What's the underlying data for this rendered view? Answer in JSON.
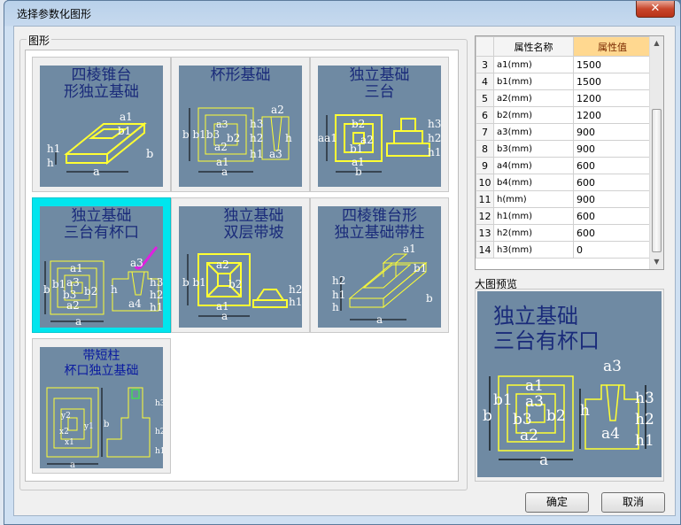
{
  "window": {
    "title": "选择参数化图形",
    "close": "✕"
  },
  "gallery": {
    "label": "图形",
    "items": [
      {
        "title": "四棱锥台\n形独立基础"
      },
      {
        "title": "杯形基础"
      },
      {
        "title": "独立基础\n三台"
      },
      {
        "title": "独立基础\n三台有杯口"
      },
      {
        "title": "独立基础\n双层带坡"
      },
      {
        "title": "四棱锥台形\n独立基础带柱"
      },
      {
        "title": "带短柱\n杯口独立基础"
      }
    ]
  },
  "properties": {
    "header_name": "属性名称",
    "header_value": "属性值",
    "rows": [
      {
        "n": "3",
        "name": "a1(mm)",
        "value": "1500"
      },
      {
        "n": "4",
        "name": "b1(mm)",
        "value": "1500"
      },
      {
        "n": "5",
        "name": "a2(mm)",
        "value": "1200"
      },
      {
        "n": "6",
        "name": "b2(mm)",
        "value": "1200"
      },
      {
        "n": "7",
        "name": "a3(mm)",
        "value": "900"
      },
      {
        "n": "8",
        "name": "b3(mm)",
        "value": "900"
      },
      {
        "n": "9",
        "name": "a4(mm)",
        "value": "600"
      },
      {
        "n": "10",
        "name": "b4(mm)",
        "value": "600"
      },
      {
        "n": "11",
        "name": "h(mm)",
        "value": "900"
      },
      {
        "n": "12",
        "name": "h1(mm)",
        "value": "600"
      },
      {
        "n": "13",
        "name": "h2(mm)",
        "value": "600"
      },
      {
        "n": "14",
        "name": "h3(mm)",
        "value": "0"
      }
    ]
  },
  "preview": {
    "label": "大图预览",
    "title": "独立基础\n三台有杯口"
  },
  "buttons": {
    "ok": "确定",
    "cancel": "取消"
  },
  "colors": {
    "thumb_bg": "#6f8aa3",
    "selection": "#00e5ee",
    "drawing": "#ffff33",
    "annotation": "#e020e0"
  }
}
